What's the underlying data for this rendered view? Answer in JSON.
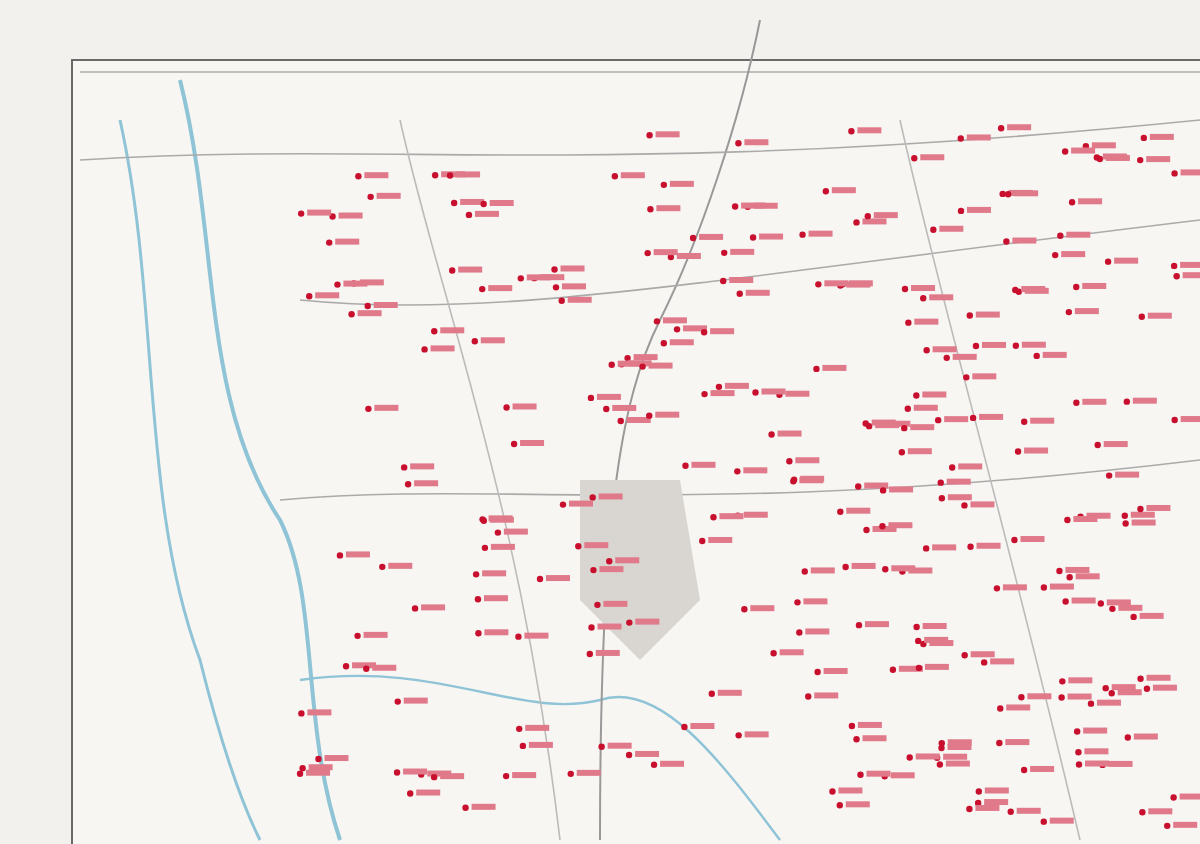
{
  "map": {
    "kind": "scanned-map"
  }
}
